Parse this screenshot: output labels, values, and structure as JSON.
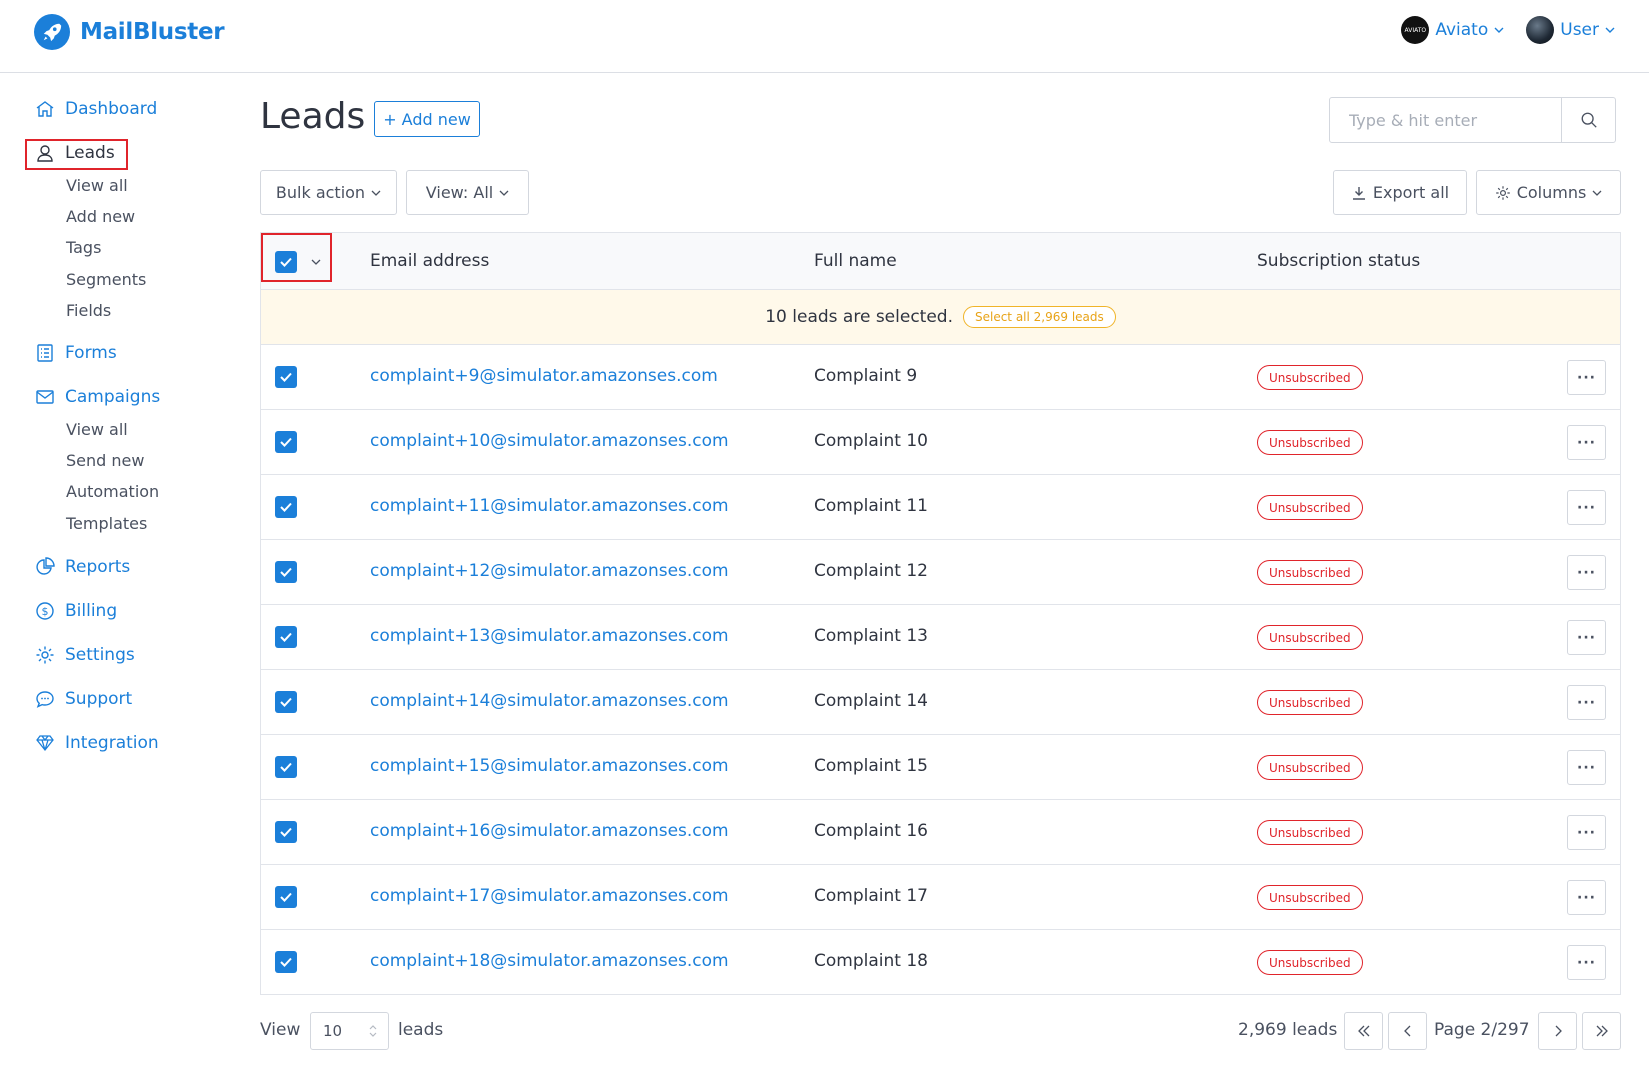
{
  "app": {
    "name": "MailBluster"
  },
  "header": {
    "org_menu": {
      "label": "Aviato",
      "avatar_text": "AVIATO"
    },
    "user_menu": {
      "label": "User"
    }
  },
  "sidebar": {
    "dashboard": "Dashboard",
    "leads": "Leads",
    "leads_sub": [
      "View all",
      "Add new",
      "Tags",
      "Segments",
      "Fields"
    ],
    "forms": "Forms",
    "campaigns": "Campaigns",
    "campaigns_sub": [
      "View all",
      "Send new",
      "Automation",
      "Templates"
    ],
    "reports": "Reports",
    "billing": "Billing",
    "settings": "Settings",
    "support": "Support",
    "integration": "Integration"
  },
  "main": {
    "title": "Leads",
    "add_new": "+ Add new",
    "search_placeholder": "Type & hit enter",
    "bulk_action": "Bulk action",
    "view_filter": "View: All",
    "export_all": "Export all",
    "columns": "Columns"
  },
  "table": {
    "headers": {
      "email": "Email address",
      "name": "Full name",
      "status": "Subscription status"
    },
    "selection_text": "10 leads are selected.",
    "select_all": "Select all 2,969 leads",
    "more_label": "···",
    "rows": [
      {
        "email": "complaint+9@simulator.amazonses.com",
        "name": "Complaint 9",
        "status": "Unsubscribed"
      },
      {
        "email": "complaint+10@simulator.amazonses.com",
        "name": "Complaint 10",
        "status": "Unsubscribed"
      },
      {
        "email": "complaint+11@simulator.amazonses.com",
        "name": "Complaint 11",
        "status": "Unsubscribed"
      },
      {
        "email": "complaint+12@simulator.amazonses.com",
        "name": "Complaint 12",
        "status": "Unsubscribed"
      },
      {
        "email": "complaint+13@simulator.amazonses.com",
        "name": "Complaint 13",
        "status": "Unsubscribed"
      },
      {
        "email": "complaint+14@simulator.amazonses.com",
        "name": "Complaint 14",
        "status": "Unsubscribed"
      },
      {
        "email": "complaint+15@simulator.amazonses.com",
        "name": "Complaint 15",
        "status": "Unsubscribed"
      },
      {
        "email": "complaint+16@simulator.amazonses.com",
        "name": "Complaint 16",
        "status": "Unsubscribed"
      },
      {
        "email": "complaint+17@simulator.amazonses.com",
        "name": "Complaint 17",
        "status": "Unsubscribed"
      },
      {
        "email": "complaint+18@simulator.amazonses.com",
        "name": "Complaint 18",
        "status": "Unsubscribed"
      }
    ]
  },
  "footer": {
    "view_label": "View",
    "per_page": "10",
    "leads_label": "leads",
    "total": "2,969 leads",
    "page": "Page 2/297"
  },
  "colors": {
    "accent": "#1b7fd9",
    "danger": "#e0242b",
    "highlight": "#fff9ea",
    "pill": "#f0b429"
  }
}
